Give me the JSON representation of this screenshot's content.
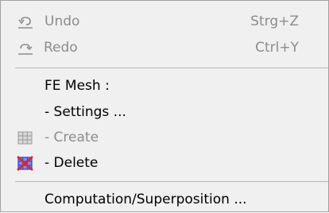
{
  "menu": {
    "undo": {
      "label": "Undo",
      "shortcut": "Strg+Z",
      "enabled": false,
      "icon": "undo-icon"
    },
    "redo": {
      "label": "Redo",
      "shortcut": "Ctrl+Y",
      "enabled": false,
      "icon": "redo-icon"
    },
    "fe_mesh_heading": "FE Mesh :",
    "settings": {
      "label": "- Settings ...",
      "enabled": true
    },
    "create": {
      "label": "- Create",
      "enabled": false,
      "icon": "mesh-grid-icon"
    },
    "delete": {
      "label": "- Delete",
      "enabled": true,
      "icon": "delete-mesh-icon"
    },
    "computation": {
      "label": "Computation/Superposition ...",
      "enabled": true
    }
  },
  "colors": {
    "background": "#f0f0f0",
    "disabled_text": "#8c8c8c",
    "separator": "#b8b8b8",
    "delete_icon_mesh": "#1f3fd6",
    "delete_icon_cross": "#e0232b"
  }
}
